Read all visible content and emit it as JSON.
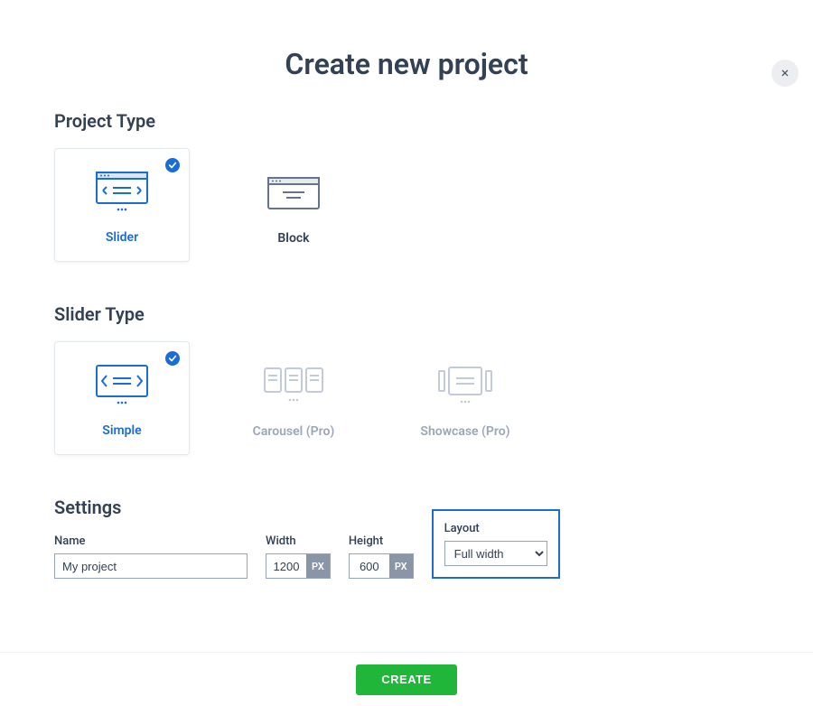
{
  "close_label": "×",
  "title": "Create new project",
  "project_type": {
    "heading": "Project Type",
    "options": [
      {
        "label": "Slider",
        "selected": true
      },
      {
        "label": "Block",
        "selected": false
      }
    ]
  },
  "slider_type": {
    "heading": "Slider Type",
    "options": [
      {
        "label": "Simple",
        "selected": true,
        "disabled": false
      },
      {
        "label": "Carousel (Pro)",
        "selected": false,
        "disabled": true
      },
      {
        "label": "Showcase (Pro)",
        "selected": false,
        "disabled": true
      }
    ]
  },
  "settings": {
    "heading": "Settings",
    "name": {
      "label": "Name",
      "value": "My project"
    },
    "width": {
      "label": "Width",
      "value": "1200",
      "unit": "PX"
    },
    "height": {
      "label": "Height",
      "value": "600",
      "unit": "PX"
    },
    "layout": {
      "label": "Layout",
      "value": "Full width"
    }
  },
  "footer": {
    "create_label": "CREATE"
  },
  "colors": {
    "accent": "#1a6dd6",
    "create_button": "#1fb63a",
    "disabled": "#c2ccd8"
  }
}
